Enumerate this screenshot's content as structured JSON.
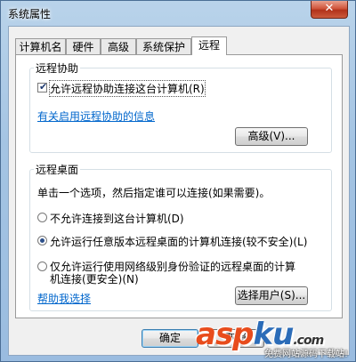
{
  "window": {
    "title": "系统属性",
    "close_label": "✕"
  },
  "tabs": [
    {
      "label": "计算机名"
    },
    {
      "label": "硬件"
    },
    {
      "label": "高级"
    },
    {
      "label": "系统保护"
    },
    {
      "label": "远程"
    }
  ],
  "remote_assistance": {
    "legend": "远程协助",
    "checkbox_label": "允许远程协助连接这台计算机(R)",
    "checkbox_checked": true,
    "info_link": "有关启用远程协助的信息",
    "advanced_button": "高级(V)..."
  },
  "remote_desktop": {
    "legend": "远程桌面",
    "instruction": "单击一个选项，然后指定谁可以连接(如果需要)。",
    "options": [
      {
        "label": "不允许连接到这台计算机(D)",
        "selected": false
      },
      {
        "label": "允许运行任意版本远程桌面的计算机连接(较不安全)(L)",
        "selected": true
      },
      {
        "label": "仅允许运行使用网络级别身份验证的远程桌面的计算",
        "label_line2": "机连接(更安全)(N)",
        "selected": false
      }
    ],
    "help_link": "帮助我选择",
    "select_users_button": "选择用户(S)..."
  },
  "footer": {
    "ok_button": "确定",
    "cancel_button": "取消"
  },
  "watermark": {
    "logo_main": "asp",
    "logo_tail": "ku",
    "logo_ext": ".com",
    "subtitle": "免费网站源码下载站!"
  }
}
